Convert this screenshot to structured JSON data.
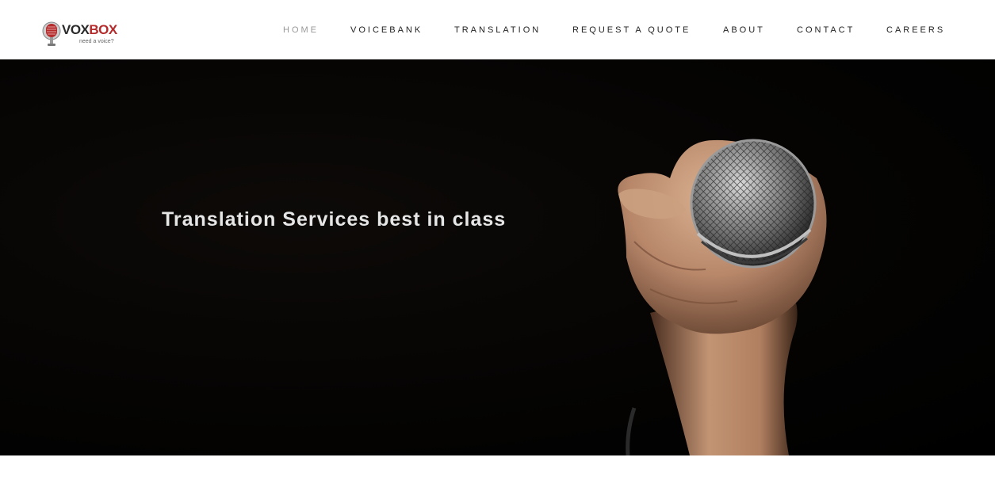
{
  "brand": {
    "name_part1": "VOX",
    "name_part2": "BOX",
    "tagline": "need a voice?",
    "accent_color": "#b52a2a"
  },
  "nav": {
    "items": [
      {
        "label": "HOME",
        "active": true
      },
      {
        "label": "VOICEBANK",
        "active": false
      },
      {
        "label": "TRANSLATION",
        "active": false
      },
      {
        "label": "REQUEST A QUOTE",
        "active": false
      },
      {
        "label": "ABOUT",
        "active": false
      },
      {
        "label": "CONTACT",
        "active": false
      },
      {
        "label": "CAREERS",
        "active": false
      }
    ]
  },
  "hero": {
    "title": "Translation Services best in class",
    "image": "microphone-in-hand-photo"
  },
  "icons": {
    "logo": "microphone-logo-icon"
  }
}
